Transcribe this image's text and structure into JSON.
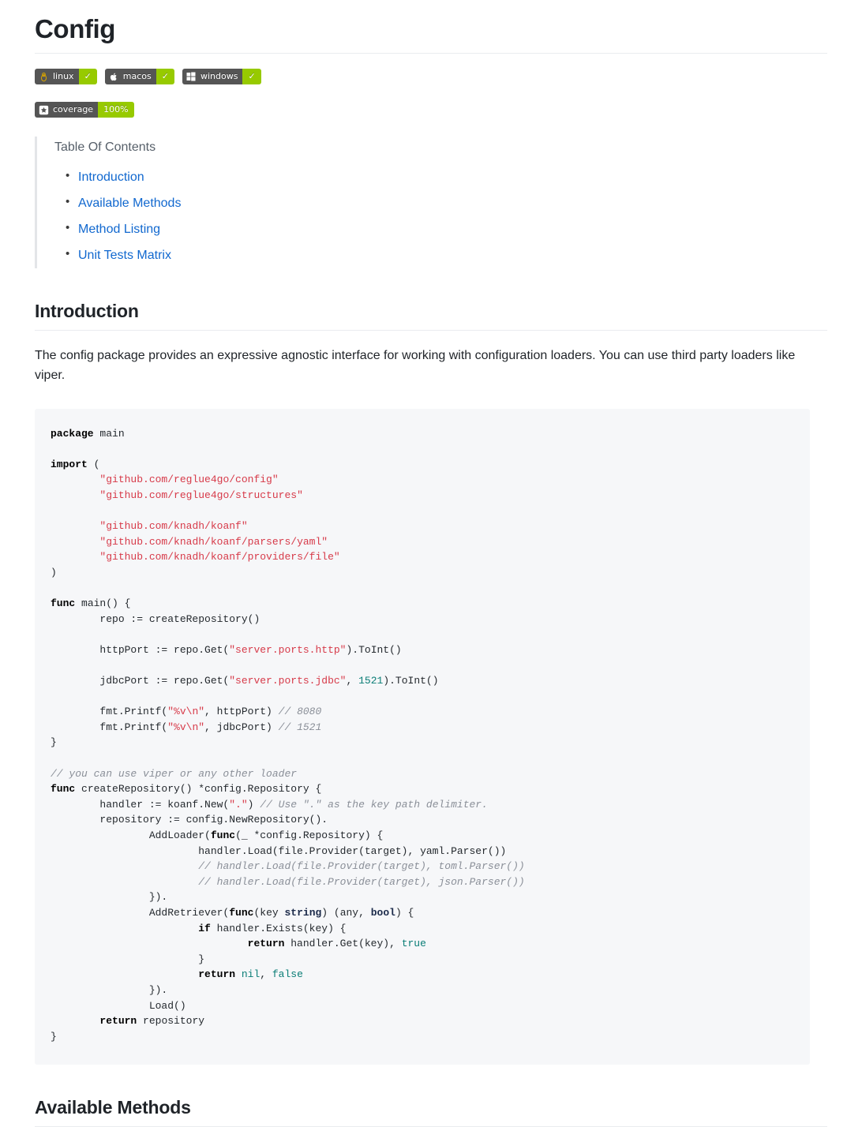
{
  "page": {
    "title": "Config"
  },
  "badges": {
    "platforms": [
      {
        "icon": "tux-linux-icon",
        "label": "linux",
        "status": "✓",
        "label_bg": "#555555",
        "status_bg": "#97ca00"
      },
      {
        "icon": "apple-icon",
        "label": "macos",
        "status": "✓",
        "label_bg": "#555555",
        "status_bg": "#97ca00"
      },
      {
        "icon": "windows-icon",
        "label": "windows",
        "status": "✓",
        "label_bg": "#555555",
        "status_bg": "#97ca00"
      }
    ],
    "coverage": {
      "icon": "codecov-star-icon",
      "label": "coverage",
      "value": "100%",
      "label_bg": "#555555",
      "value_bg": "#97ca00"
    }
  },
  "toc": {
    "title": "Table Of Contents",
    "link_color": "#1168cf",
    "items": [
      {
        "label": "Introduction"
      },
      {
        "label": "Available Methods"
      },
      {
        "label": "Method Listing"
      },
      {
        "label": "Unit Tests Matrix"
      }
    ]
  },
  "sections": {
    "introduction": {
      "heading": "Introduction",
      "paragraph": "The config package provides an expressive agnostic interface for working with configuration loaders. You can use third party loaders like viper."
    },
    "available_methods": {
      "heading": "Available Methods"
    }
  },
  "code": {
    "language": "go",
    "background": "#f6f7f9",
    "lines": [
      [
        {
          "t": "package",
          "c": "k"
        },
        {
          "t": " main",
          "c": ""
        }
      ],
      [
        {
          "t": "",
          "c": ""
        }
      ],
      [
        {
          "t": "import",
          "c": "k"
        },
        {
          "t": " (",
          "c": ""
        }
      ],
      [
        {
          "t": "        ",
          "c": ""
        },
        {
          "t": "\"github.com/reglue4go/config\"",
          "c": "s"
        }
      ],
      [
        {
          "t": "        ",
          "c": ""
        },
        {
          "t": "\"github.com/reglue4go/structures\"",
          "c": "s"
        }
      ],
      [
        {
          "t": "",
          "c": ""
        }
      ],
      [
        {
          "t": "        ",
          "c": ""
        },
        {
          "t": "\"github.com/knadh/koanf\"",
          "c": "s"
        }
      ],
      [
        {
          "t": "        ",
          "c": ""
        },
        {
          "t": "\"github.com/knadh/koanf/parsers/yaml\"",
          "c": "s"
        }
      ],
      [
        {
          "t": "        ",
          "c": ""
        },
        {
          "t": "\"github.com/knadh/koanf/providers/file\"",
          "c": "s"
        }
      ],
      [
        {
          "t": ")",
          "c": ""
        }
      ],
      [
        {
          "t": "",
          "c": ""
        }
      ],
      [
        {
          "t": "func",
          "c": "k"
        },
        {
          "t": " main() {",
          "c": ""
        }
      ],
      [
        {
          "t": "        repo := createRepository()",
          "c": ""
        }
      ],
      [
        {
          "t": "",
          "c": ""
        }
      ],
      [
        {
          "t": "        httpPort := repo.Get(",
          "c": ""
        },
        {
          "t": "\"server.ports.http\"",
          "c": "s"
        },
        {
          "t": ").ToInt()",
          "c": ""
        }
      ],
      [
        {
          "t": "",
          "c": ""
        }
      ],
      [
        {
          "t": "        jdbcPort := repo.Get(",
          "c": ""
        },
        {
          "t": "\"server.ports.jdbc\"",
          "c": "s"
        },
        {
          "t": ", ",
          "c": ""
        },
        {
          "t": "1521",
          "c": "m"
        },
        {
          "t": ").ToInt()",
          "c": ""
        }
      ],
      [
        {
          "t": "",
          "c": ""
        }
      ],
      [
        {
          "t": "        fmt.Printf(",
          "c": ""
        },
        {
          "t": "\"%v\\n\"",
          "c": "s"
        },
        {
          "t": ", httpPort) ",
          "c": ""
        },
        {
          "t": "// 8080",
          "c": "c"
        }
      ],
      [
        {
          "t": "        fmt.Printf(",
          "c": ""
        },
        {
          "t": "\"%v\\n\"",
          "c": "s"
        },
        {
          "t": ", jdbcPort) ",
          "c": ""
        },
        {
          "t": "// 1521",
          "c": "c"
        }
      ],
      [
        {
          "t": "}",
          "c": ""
        }
      ],
      [
        {
          "t": "",
          "c": ""
        }
      ],
      [
        {
          "t": "// you can use viper or any other loader",
          "c": "c"
        }
      ],
      [
        {
          "t": "func",
          "c": "k"
        },
        {
          "t": " createRepository() *config.Repository {",
          "c": ""
        }
      ],
      [
        {
          "t": "        handler := koanf.New(",
          "c": ""
        },
        {
          "t": "\".\"",
          "c": "s"
        },
        {
          "t": ") ",
          "c": ""
        },
        {
          "t": "// Use \".\" as the key path delimiter.",
          "c": "c"
        }
      ],
      [
        {
          "t": "        repository := config.NewRepository().",
          "c": ""
        }
      ],
      [
        {
          "t": "                AddLoader(",
          "c": ""
        },
        {
          "t": "func",
          "c": "k"
        },
        {
          "t": "(_ *config.Repository) {",
          "c": ""
        }
      ],
      [
        {
          "t": "                        handler.Load(file.Provider(target), yaml.Parser())",
          "c": ""
        }
      ],
      [
        {
          "t": "                        ",
          "c": ""
        },
        {
          "t": "// handler.Load(file.Provider(target), toml.Parser())",
          "c": "c"
        }
      ],
      [
        {
          "t": "                        ",
          "c": ""
        },
        {
          "t": "// handler.Load(file.Provider(target), json.Parser())",
          "c": "c"
        }
      ],
      [
        {
          "t": "                }).",
          "c": ""
        }
      ],
      [
        {
          "t": "                AddRetriever(",
          "c": ""
        },
        {
          "t": "func",
          "c": "k"
        },
        {
          "t": "(key ",
          "c": ""
        },
        {
          "t": "string",
          "c": "kt"
        },
        {
          "t": ") (any, ",
          "c": ""
        },
        {
          "t": "bool",
          "c": "kt"
        },
        {
          "t": ") {",
          "c": ""
        }
      ],
      [
        {
          "t": "                        ",
          "c": ""
        },
        {
          "t": "if",
          "c": "k"
        },
        {
          "t": " handler.Exists(key) {",
          "c": ""
        }
      ],
      [
        {
          "t": "                                ",
          "c": ""
        },
        {
          "t": "return",
          "c": "k"
        },
        {
          "t": " handler.Get(key), ",
          "c": ""
        },
        {
          "t": "true",
          "c": "bo"
        }
      ],
      [
        {
          "t": "                        }",
          "c": ""
        }
      ],
      [
        {
          "t": "                        ",
          "c": ""
        },
        {
          "t": "return",
          "c": "k"
        },
        {
          "t": " ",
          "c": ""
        },
        {
          "t": "nil",
          "c": "bo"
        },
        {
          "t": ", ",
          "c": ""
        },
        {
          "t": "false",
          "c": "bo"
        }
      ],
      [
        {
          "t": "                }).",
          "c": ""
        }
      ],
      [
        {
          "t": "                Load()",
          "c": ""
        }
      ],
      [
        {
          "t": "        ",
          "c": ""
        },
        {
          "t": "return",
          "c": "k"
        },
        {
          "t": " repository",
          "c": ""
        }
      ],
      [
        {
          "t": "}",
          "c": ""
        }
      ]
    ]
  }
}
